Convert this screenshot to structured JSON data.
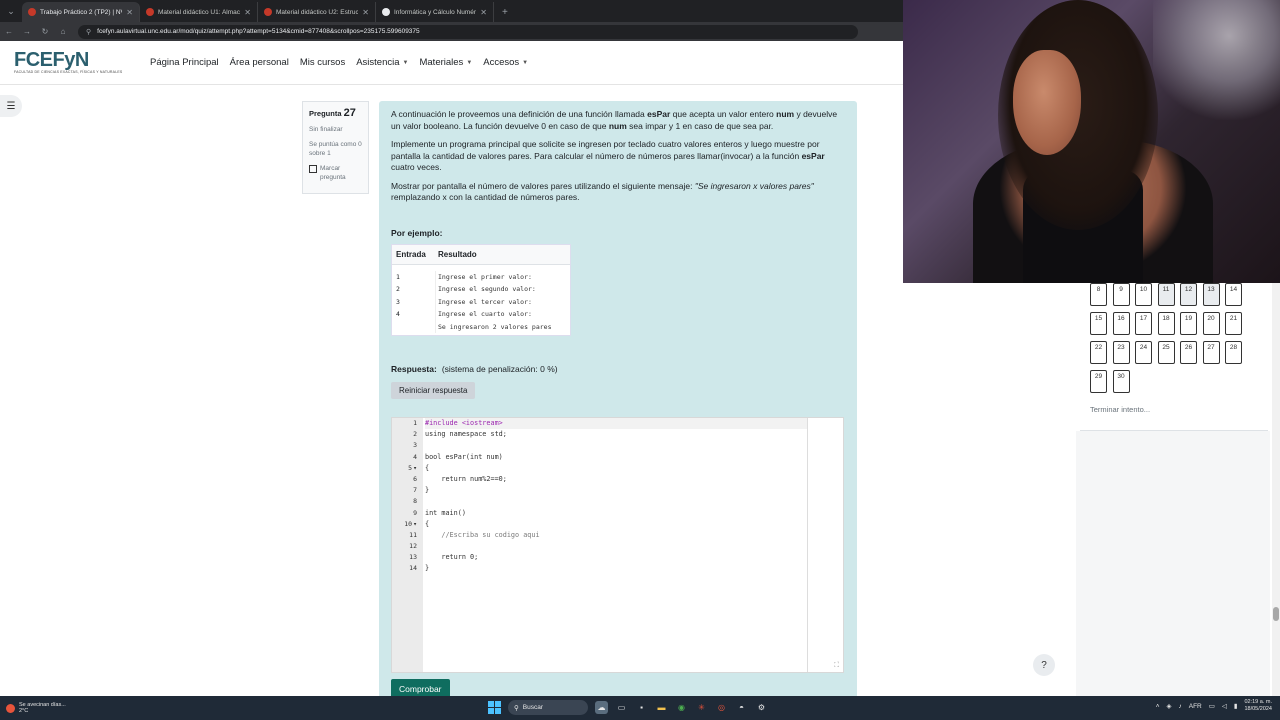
{
  "browser": {
    "tabs": [
      {
        "title": "Trabajo Práctico 2 (TP2) | NVA",
        "active": true
      },
      {
        "title": "Material didáctico U1: Almacen",
        "active": false
      },
      {
        "title": "Material didáctico U2: Estructu",
        "active": false
      },
      {
        "title": "Informática y Cálculo Numéric",
        "active": false
      }
    ],
    "url": "fcefyn.aulavirtual.unc.edu.ar/mod/quiz/attempt.php?attempt=5134&cmid=877408&scrollpos=235175.599609375"
  },
  "header": {
    "logo_text": "FCEFyN",
    "logo_subtext": "FACULTAD DE CIENCIAS EXACTAS, FÍSICAS Y NATURALES",
    "nav": [
      "Página Principal",
      "Área personal",
      "Mis cursos",
      "Asistencia",
      "Materiales",
      "Accesos"
    ]
  },
  "question_info": {
    "label": "Pregunta",
    "number": "27",
    "status": "Sin finalizar",
    "grade": "Se puntúa como 0 sobre 1",
    "flag_label": "Marcar pregunta"
  },
  "question": {
    "p1_a": "A continuación le proveemos una definición de una función llamada ",
    "p1_fn": "esPar",
    "p1_b": " que acepta un valor entero ",
    "p1_num": "num",
    "p1_c": " y devuelve un valor booleano. La función devuelve 0 en caso de que ",
    "p1_num2": "num",
    "p1_d": " sea impar y 1 en caso de que sea par.",
    "p2_a": "Implemente un programa principal que solicite se ingresen por teclado cuatro valores enteros y luego muestre por pantalla la cantidad de valores pares. Para calcular el número de números pares llamar(invocar) a la función ",
    "p2_fn": "esPar",
    "p2_b": " cuatro veces.",
    "p3_a": "Mostrar por pantalla el número de valores pares utilizando el siguiente mensaje: ",
    "p3_msg": "\"Se ingresaron x valores pares\"",
    "p3_b": " remplazando x con la cantidad de números pares.",
    "example_heading": "Por ejemplo:",
    "example_headers": [
      "Entrada",
      "Resultado"
    ],
    "example_input": [
      "1",
      "2",
      "3",
      "4"
    ],
    "example_output": [
      "Ingrese el primer valor:",
      "Ingrese el segundo valor:",
      "Ingrese el tercer valor:",
      "Ingrese el cuarto valor:",
      "Se ingresaron 2 valores pares"
    ],
    "answer_label": "Respuesta:",
    "penalty": "(sistema de penalización: 0 %)",
    "reset_label": "Reiniciar respuesta",
    "check_label": "Comprobar"
  },
  "code_lines": [
    {
      "n": "1",
      "fold": "",
      "text": "#include <iostream>"
    },
    {
      "n": "2",
      "fold": "",
      "text": "using namespace std;"
    },
    {
      "n": "3",
      "fold": "",
      "text": ""
    },
    {
      "n": "4",
      "fold": "",
      "text": "bool esPar(int num)"
    },
    {
      "n": "5",
      "fold": "▾",
      "text": "{"
    },
    {
      "n": "6",
      "fold": "",
      "text": "    return num%2==0;"
    },
    {
      "n": "7",
      "fold": "",
      "text": "}"
    },
    {
      "n": "8",
      "fold": "",
      "text": ""
    },
    {
      "n": "9",
      "fold": "",
      "text": "int main()"
    },
    {
      "n": "10",
      "fold": "▾",
      "text": "{"
    },
    {
      "n": "11",
      "fold": "",
      "text": "    //Escriba su codigo aqui"
    },
    {
      "n": "12",
      "fold": "",
      "text": ""
    },
    {
      "n": "13",
      "fold": "",
      "text": "    return 0;"
    },
    {
      "n": "14",
      "fold": "",
      "text": "}"
    }
  ],
  "quiz_nav": {
    "buttons": [
      "8",
      "9",
      "10",
      "11",
      "12",
      "13",
      "14",
      "15",
      "16",
      "17",
      "18",
      "19",
      "20",
      "21",
      "22",
      "23",
      "24",
      "25",
      "26",
      "27",
      "28",
      "29",
      "30"
    ],
    "finish_label": "Terminar intento..."
  },
  "help_label": "?",
  "taskbar": {
    "weather_line1": "Se avecinan días...",
    "weather_line2": "2°C",
    "search_label": "Buscar",
    "lang": "AFR",
    "time": "02:19 a. m.",
    "date": "18/05/2024"
  }
}
